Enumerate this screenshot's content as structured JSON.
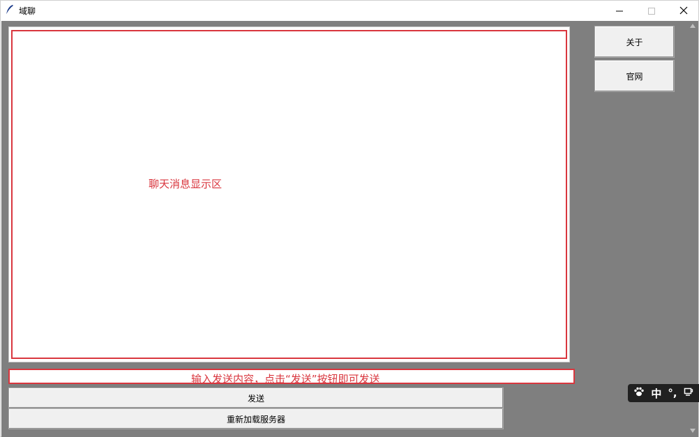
{
  "window": {
    "title": "域聊",
    "controls": {
      "minimize": "minimize",
      "maximize": "maximize",
      "close": "close"
    }
  },
  "chat": {
    "hint": "聊天消息显示区"
  },
  "sidebar": {
    "about_label": "关于",
    "site_label": "官网"
  },
  "input": {
    "hint": "输入发送内容，点击“发送”按钮即可发送",
    "value": ""
  },
  "actions": {
    "send_label": "发送",
    "reload_label": "重新加载服务器"
  },
  "ime": {
    "paw_icon": "paw-icon",
    "mode": "中",
    "punct": "°,",
    "cup_icon": "cup-icon"
  },
  "colors": {
    "accent": "#d9363e",
    "client_bg": "#7f7f7f",
    "button_bg": "#f0f0f0"
  }
}
